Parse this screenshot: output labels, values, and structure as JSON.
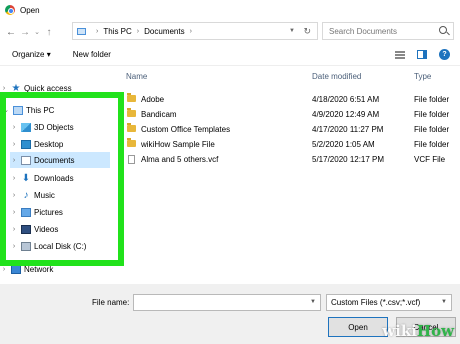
{
  "window": {
    "title": "Open"
  },
  "address": {
    "crumbs": [
      "This PC",
      "Documents"
    ],
    "search_placeholder": "Search Documents"
  },
  "toolbar": {
    "organize": "Organize",
    "new_folder": "New folder"
  },
  "nav": {
    "items": [
      {
        "label": "Quick access",
        "icon": "star-icon"
      },
      {
        "label": "This PC",
        "icon": "pc-icon"
      },
      {
        "label": "3D Objects",
        "icon": "cube-icon"
      },
      {
        "label": "Desktop",
        "icon": "desktop-icon"
      },
      {
        "label": "Documents",
        "icon": "documents-icon"
      },
      {
        "label": "Downloads",
        "icon": "download-icon"
      },
      {
        "label": "Music",
        "icon": "music-icon"
      },
      {
        "label": "Pictures",
        "icon": "pictures-icon"
      },
      {
        "label": "Videos",
        "icon": "videos-icon"
      },
      {
        "label": "Local Disk (C:)",
        "icon": "disk-icon"
      },
      {
        "label": "Network",
        "icon": "network-icon"
      }
    ],
    "selected": "Documents"
  },
  "list": {
    "columns": {
      "name": "Name",
      "date": "Date modified",
      "type": "Type"
    },
    "rows": [
      {
        "name": "Adobe",
        "date": "4/18/2020 6:51 AM",
        "type": "File folder",
        "icon": "folder-icon"
      },
      {
        "name": "Bandicam",
        "date": "4/9/2020 12:49 AM",
        "type": "File folder",
        "icon": "folder-icon"
      },
      {
        "name": "Custom Office Templates",
        "date": "4/17/2020 11:27 PM",
        "type": "File folder",
        "icon": "folder-icon"
      },
      {
        "name": "wikiHow Sample File",
        "date": "5/2/2020 1:05 AM",
        "type": "File folder",
        "icon": "folder-icon"
      },
      {
        "name": "Alma and 5 others.vcf",
        "date": "5/17/2020 12:17 PM",
        "type": "VCF File",
        "icon": "vcf-file-icon"
      }
    ]
  },
  "bottom": {
    "file_name_label": "File name:",
    "file_name_value": "",
    "filter": "Custom Files (*.csv;*.vcf)",
    "open": "Open",
    "cancel": "Cancel"
  },
  "watermark": {
    "wiki": "wiki",
    "how": "How"
  },
  "colors": {
    "highlight": "#21e21b",
    "selection": "#cce8ff",
    "accent": "#1e73be"
  }
}
